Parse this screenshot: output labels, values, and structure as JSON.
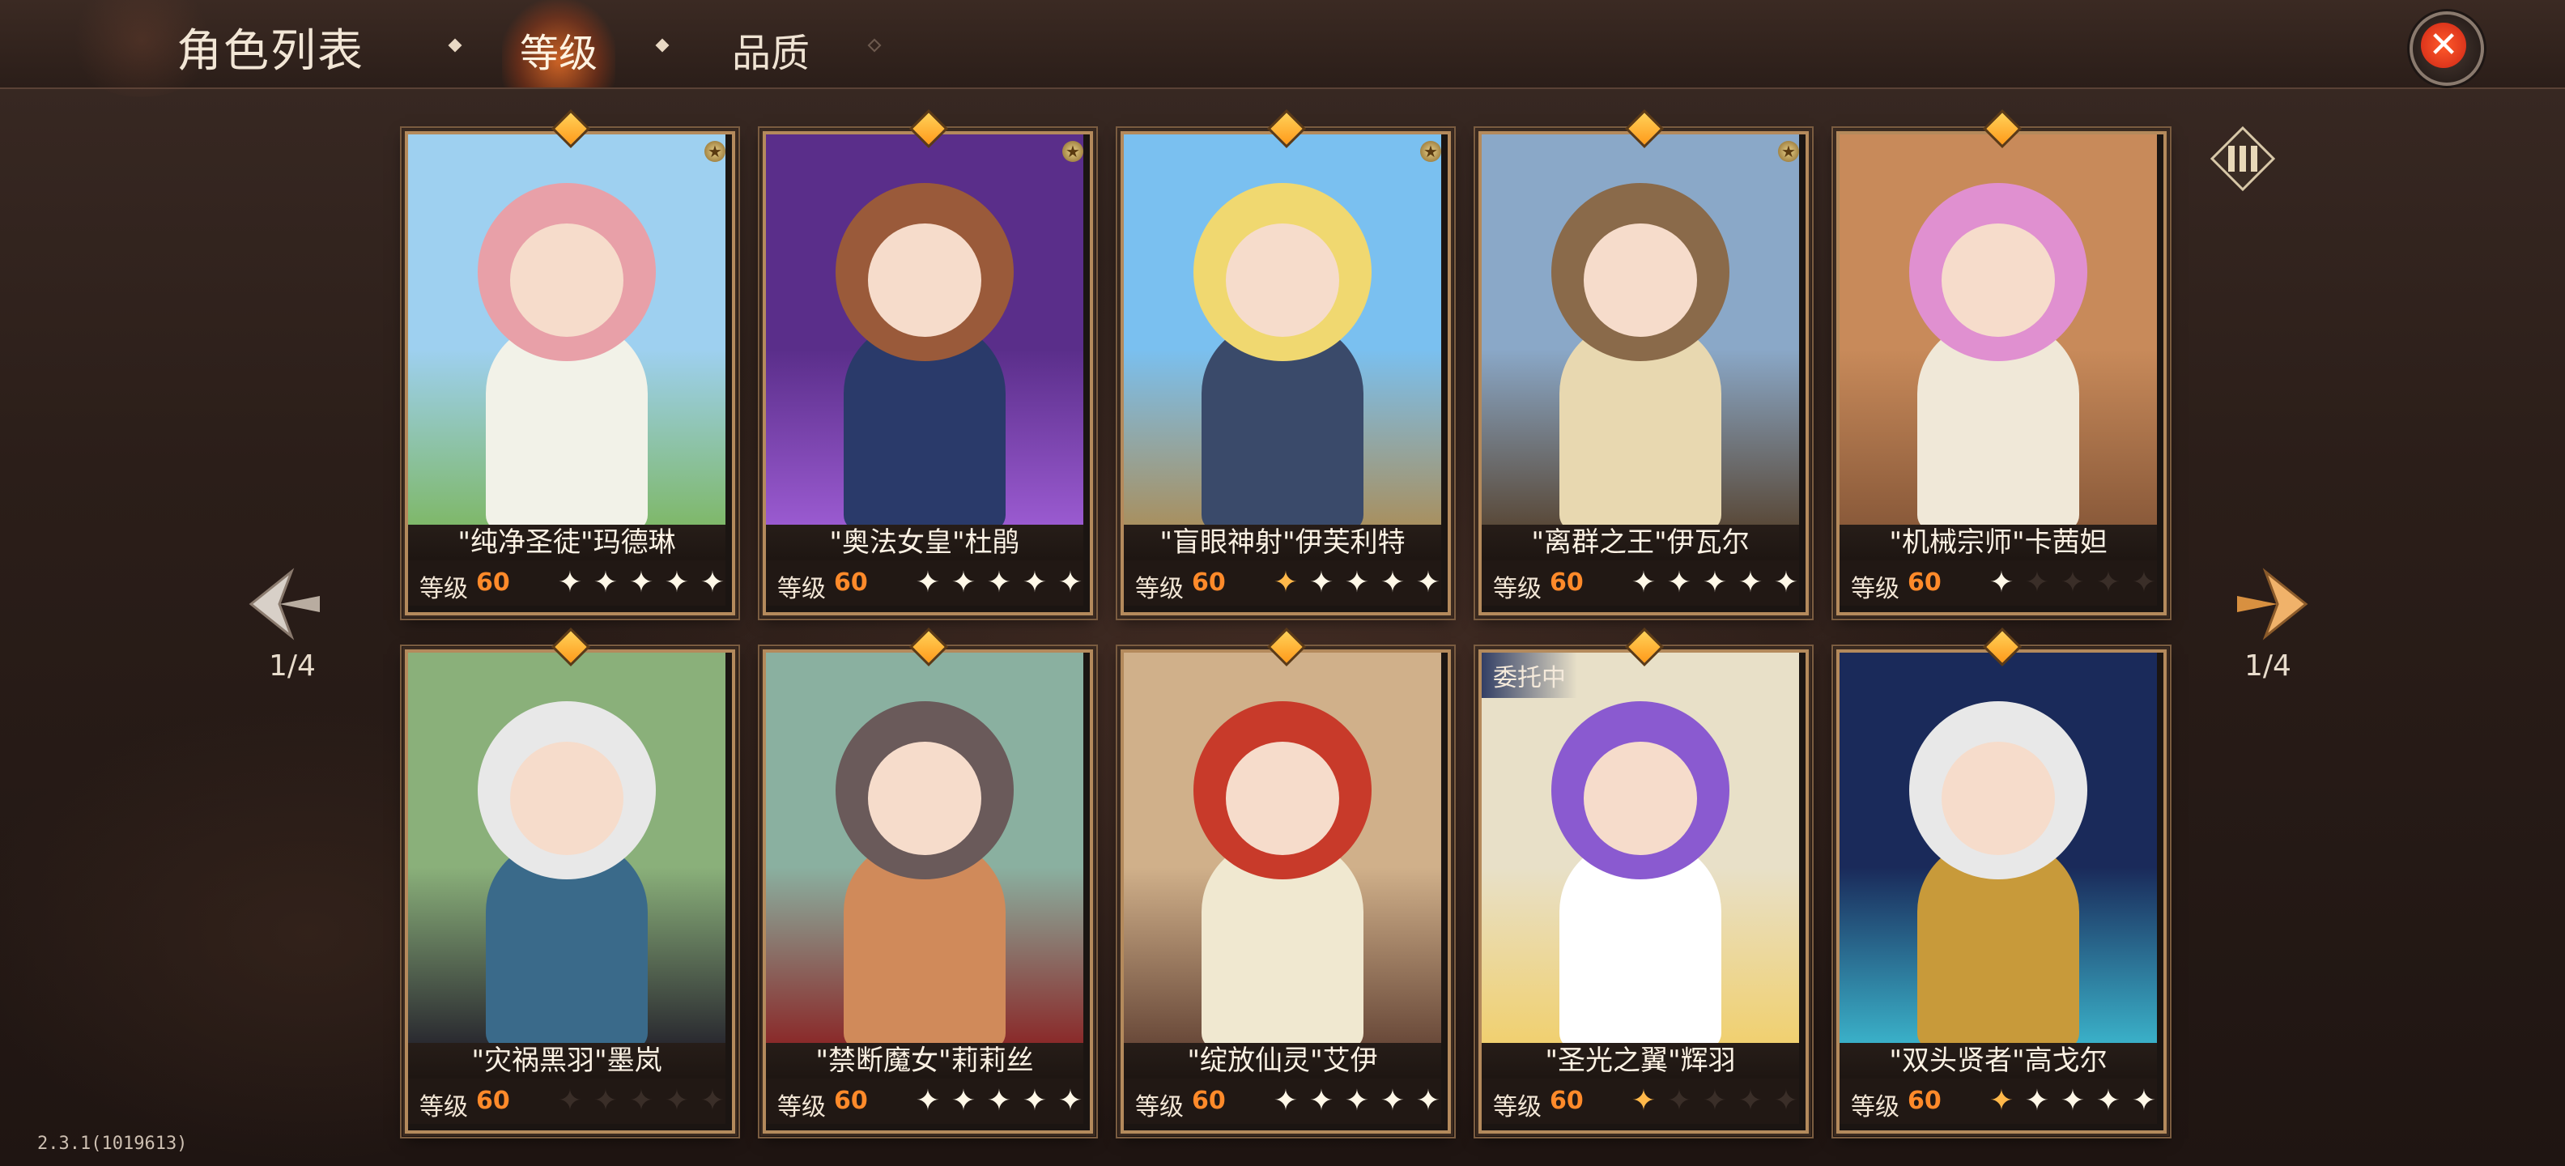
{
  "header": {
    "title": "角色列表",
    "tabs": [
      {
        "label": "等级",
        "active": true
      },
      {
        "label": "品质",
        "active": false
      }
    ],
    "close_icon": "close-icon"
  },
  "pagination": {
    "left_page": "1/4",
    "right_page": "1/4"
  },
  "version": "2.3.1(1019613)",
  "level_label": "等级",
  "cards": [
    {
      "name": "\"纯净圣徒\"玛德琳",
      "level": "60",
      "stars": 5,
      "half": 0,
      "corner_star": true,
      "badge": "",
      "art_colors": [
        "#9ed0f0",
        "#7fb86a",
        "#e8a0a8",
        "#f2f2e8"
      ]
    },
    {
      "name": "\"奥法女皇\"杜鹃",
      "level": "60",
      "stars": 5,
      "half": 0,
      "corner_star": true,
      "badge": "",
      "art_colors": [
        "#5a2e8a",
        "#9a5ad0",
        "#9a5a3a",
        "#2a3a6a"
      ]
    },
    {
      "name": "\"盲眼神射\"伊芙利特",
      "level": "60",
      "stars": 4,
      "half": 1,
      "corner_star": true,
      "badge": "",
      "art_colors": [
        "#7ac0f0",
        "#a89060",
        "#f0d870",
        "#3a4a6a"
      ]
    },
    {
      "name": "\"离群之王\"伊瓦尔",
      "level": "60",
      "stars": 5,
      "half": 0,
      "corner_star": true,
      "badge": "",
      "art_colors": [
        "#8aa8c8",
        "#5a4a3a",
        "#8a6a4a",
        "#e8d8b0"
      ]
    },
    {
      "name": "\"机械宗师\"卡茜妲",
      "level": "60",
      "stars": 1,
      "half": 0,
      "corner_star": false,
      "badge": "",
      "art_colors": [
        "#c88a5a",
        "#8a5a3a",
        "#e090d0",
        "#f0e8d8"
      ]
    },
    {
      "name": "\"灾祸黑羽\"墨岚",
      "level": "60",
      "stars": 0,
      "half": 0,
      "corner_star": false,
      "badge": "",
      "art_colors": [
        "#8ab07a",
        "#2a2a30",
        "#e8e8e8",
        "#3a6a8a"
      ]
    },
    {
      "name": "\"禁断魔女\"莉莉丝",
      "level": "60",
      "stars": 5,
      "half": 0,
      "corner_star": false,
      "badge": "",
      "art_colors": [
        "#8ab0a0",
        "#8a2a2a",
        "#6a5a5a",
        "#d08a5a"
      ]
    },
    {
      "name": "\"绽放仙灵\"艾伊",
      "level": "60",
      "stars": 5,
      "half": 0,
      "corner_star": false,
      "badge": "",
      "art_colors": [
        "#d0b08a",
        "#6a4a3a",
        "#c83a2a",
        "#f0e8d0"
      ]
    },
    {
      "name": "\"圣光之翼\"辉羽",
      "level": "60",
      "stars": 0,
      "half": 1,
      "corner_star": false,
      "badge": "委托中",
      "art_colors": [
        "#e8e0c8",
        "#f0d070",
        "#8a5ad0",
        "#ffffff"
      ]
    },
    {
      "name": "\"双头贤者\"高戈尔",
      "level": "60",
      "stars": 4,
      "half": 1,
      "corner_star": false,
      "badge": "",
      "art_colors": [
        "#1a2a5a",
        "#3ab0c8",
        "#e8e8e8",
        "#c89a3a"
      ]
    }
  ]
}
